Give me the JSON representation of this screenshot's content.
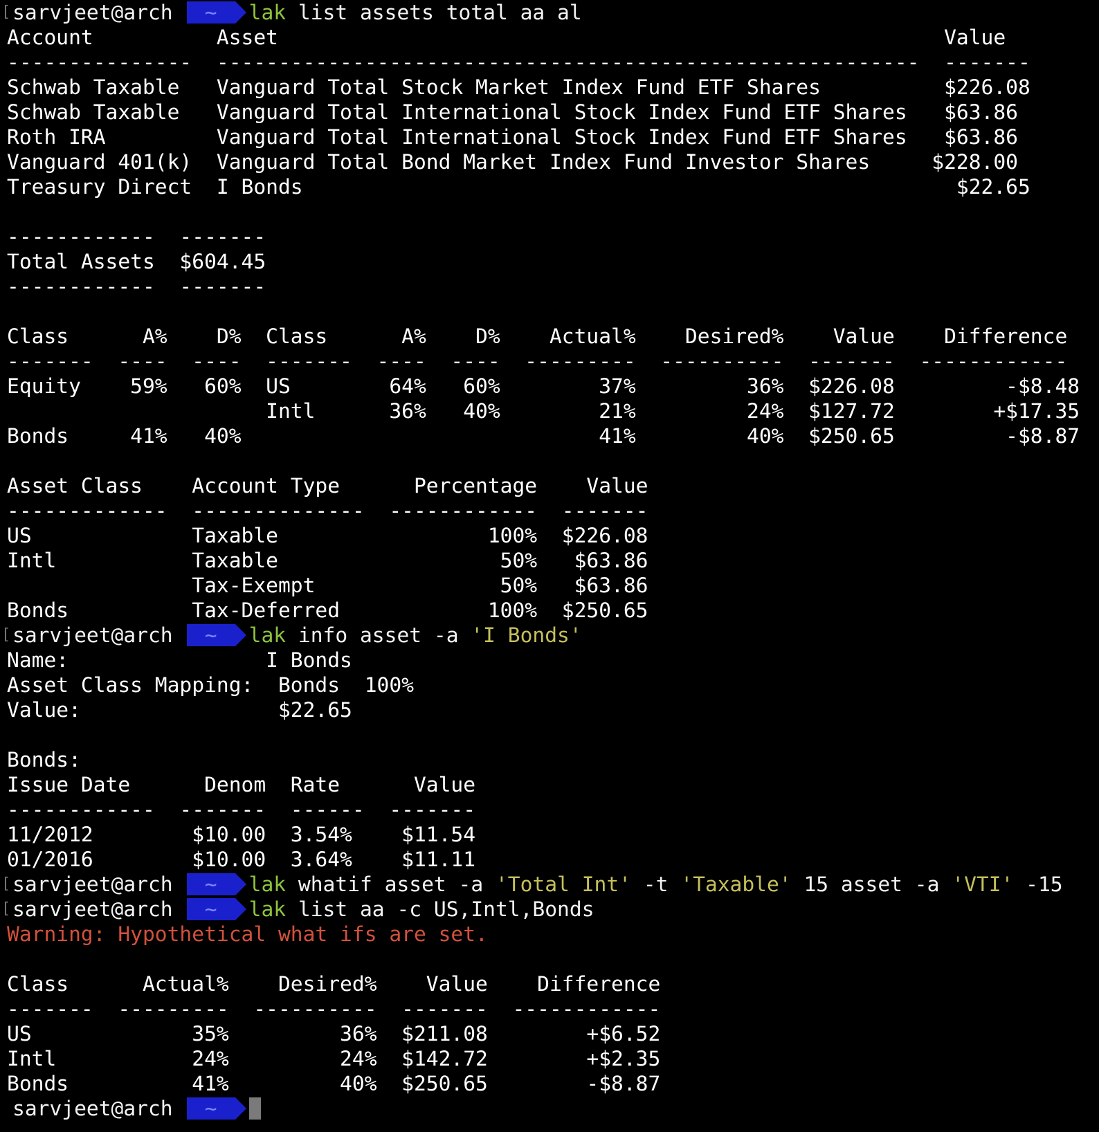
{
  "prompt": {
    "user_host": "sarvjeet@arch",
    "dir": "~"
  },
  "session": [
    {
      "kind": "cmd",
      "cmd_name": "lak",
      "args": [
        {
          "t": "list assets total aa al"
        }
      ]
    },
    {
      "kind": "out",
      "text": "Account          Asset                                                      Value"
    },
    {
      "kind": "out",
      "text": "---------------  ---------------------------------------------------------  -------"
    },
    {
      "kind": "out",
      "text": "Schwab Taxable   Vanguard Total Stock Market Index Fund ETF Shares          $226.08"
    },
    {
      "kind": "out",
      "text": "Schwab Taxable   Vanguard Total International Stock Index Fund ETF Shares   $63.86"
    },
    {
      "kind": "out",
      "text": "Roth IRA         Vanguard Total International Stock Index Fund ETF Shares   $63.86"
    },
    {
      "kind": "out",
      "text": "Vanguard 401(k)  Vanguard Total Bond Market Index Fund Investor Shares     $228.00"
    },
    {
      "kind": "out",
      "text": "Treasury Direct  I Bonds                                                     $22.65"
    },
    {
      "kind": "out",
      "text": ""
    },
    {
      "kind": "out",
      "text": "------------  -------"
    },
    {
      "kind": "out",
      "text": "Total Assets  $604.45"
    },
    {
      "kind": "out",
      "text": "------------  -------"
    },
    {
      "kind": "out",
      "text": ""
    },
    {
      "kind": "out",
      "text": "Class      A%    D%  Class      A%    D%    Actual%    Desired%    Value    Difference"
    },
    {
      "kind": "out",
      "text": "-------  ----  ----  -------  ----  ----  ---------  ----------  -------  ------------"
    },
    {
      "kind": "out",
      "text": "Equity    59%   60%  US        64%   60%        37%         36%  $226.08         -$8.48"
    },
    {
      "kind": "out",
      "text": "                     Intl      36%   40%        21%         24%  $127.72        +$17.35"
    },
    {
      "kind": "out",
      "text": "Bonds     41%   40%                             41%         40%  $250.65         -$8.87"
    },
    {
      "kind": "out",
      "text": ""
    },
    {
      "kind": "out",
      "text": "Asset Class    Account Type      Percentage    Value"
    },
    {
      "kind": "out",
      "text": "-------------  --------------  ------------  -------"
    },
    {
      "kind": "out",
      "text": "US             Taxable                 100%  $226.08"
    },
    {
      "kind": "out",
      "text": "Intl           Taxable                  50%   $63.86"
    },
    {
      "kind": "out",
      "text": "               Tax-Exempt               50%   $63.86"
    },
    {
      "kind": "out",
      "text": "Bonds          Tax-Deferred            100%  $250.65"
    },
    {
      "kind": "cmd",
      "cmd_name": "lak",
      "args": [
        {
          "t": "info asset -a "
        },
        {
          "t": "'I Bonds'",
          "c": "y"
        }
      ]
    },
    {
      "kind": "out",
      "text": "Name:                I Bonds"
    },
    {
      "kind": "out",
      "text": "Asset Class Mapping:  Bonds  100%"
    },
    {
      "kind": "out",
      "text": "Value:                $22.65"
    },
    {
      "kind": "out",
      "text": ""
    },
    {
      "kind": "out",
      "text": "Bonds:"
    },
    {
      "kind": "out",
      "text": "Issue Date      Denom  Rate      Value"
    },
    {
      "kind": "out",
      "text": "------------  -------  ------  -------"
    },
    {
      "kind": "out",
      "text": "11/2012        $10.00  3.54%    $11.54"
    },
    {
      "kind": "out",
      "text": "01/2016        $10.00  3.64%    $11.11"
    },
    {
      "kind": "cmd",
      "cmd_name": "lak",
      "args": [
        {
          "t": "whatif asset -a "
        },
        {
          "t": "'Total Int'",
          "c": "y"
        },
        {
          "t": " -t "
        },
        {
          "t": "'Taxable'",
          "c": "y"
        },
        {
          "t": " 15 asset -a "
        },
        {
          "t": "'VTI'",
          "c": "y"
        },
        {
          "t": " -15"
        }
      ]
    },
    {
      "kind": "cmd",
      "cmd_name": "lak",
      "args": [
        {
          "t": "list aa -c US,Intl,Bonds"
        }
      ]
    },
    {
      "kind": "out",
      "text": "Warning: Hypothetical what ifs are set.",
      "c": "r"
    },
    {
      "kind": "out",
      "text": ""
    },
    {
      "kind": "out",
      "text": "Class      Actual%    Desired%    Value    Difference"
    },
    {
      "kind": "out",
      "text": "-------  ---------  ----------  -------  ------------"
    },
    {
      "kind": "out",
      "text": "US             35%         36%  $211.08        +$6.52"
    },
    {
      "kind": "out",
      "text": "Intl           24%         24%  $142.72        +$2.35"
    },
    {
      "kind": "out",
      "text": "Bonds          41%         40%  $250.65        -$8.87"
    },
    {
      "kind": "prompt"
    }
  ]
}
